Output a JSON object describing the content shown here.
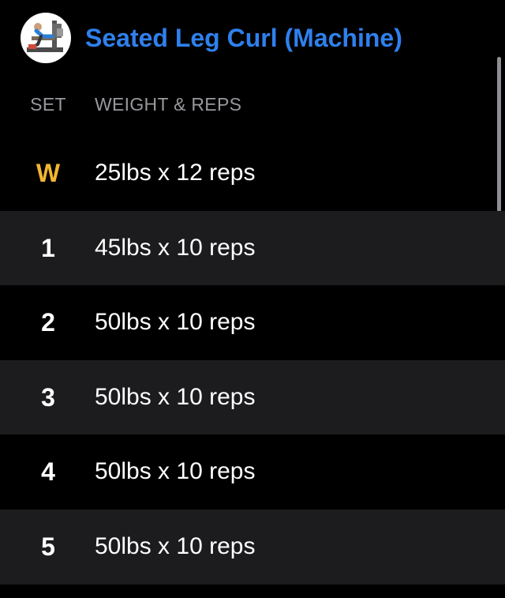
{
  "exercise": {
    "title": "Seated Leg Curl (Machine)",
    "thumbnail_icon": "leg-curl-machine-icon",
    "title_color": "#2f80ed"
  },
  "columns": {
    "set": "SET",
    "weight_reps": "WEIGHT & REPS"
  },
  "sets": [
    {
      "set": "W",
      "value": "25lbs x 12 reps",
      "type": "warmup"
    },
    {
      "set": "1",
      "value": "45lbs x 10 reps",
      "type": "normal"
    },
    {
      "set": "2",
      "value": "50lbs x 10 reps",
      "type": "normal"
    },
    {
      "set": "3",
      "value": "50lbs x 10 reps",
      "type": "normal"
    },
    {
      "set": "4",
      "value": "50lbs x 10 reps",
      "type": "normal"
    },
    {
      "set": "5",
      "value": "50lbs x 10 reps",
      "type": "normal"
    }
  ],
  "colors": {
    "background": "#000000",
    "alt_row": "#1c1c1e",
    "warmup": "#f2b632",
    "header_text": "#98989d"
  }
}
